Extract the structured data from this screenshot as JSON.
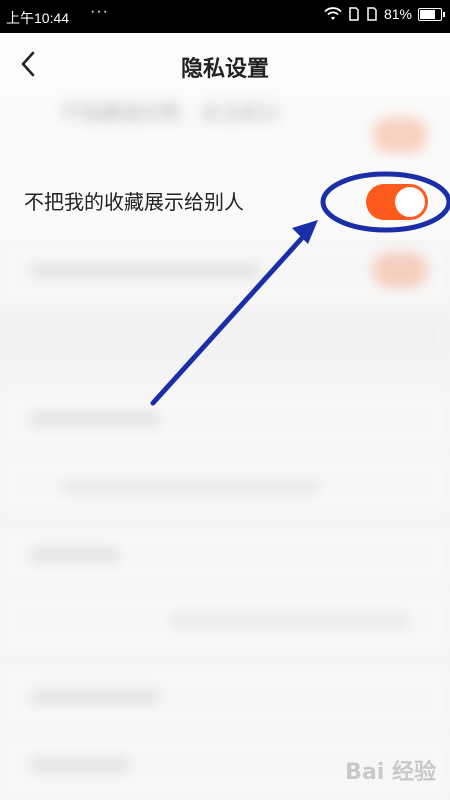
{
  "status_bar": {
    "time": "上午10:44",
    "dots": "···",
    "battery": "81%",
    "battery_level": 0.81
  },
  "nav": {
    "title": "隐私设置"
  },
  "blurred_top_text": "不隐藏我的赞、关注和分",
  "settings": [
    {
      "label": "不把我的收藏展示给别人",
      "enabled": true
    }
  ],
  "watermark": "Bai 经验",
  "colors": {
    "accent": "#ff5a1e",
    "annotation": "#1a2ea8"
  }
}
